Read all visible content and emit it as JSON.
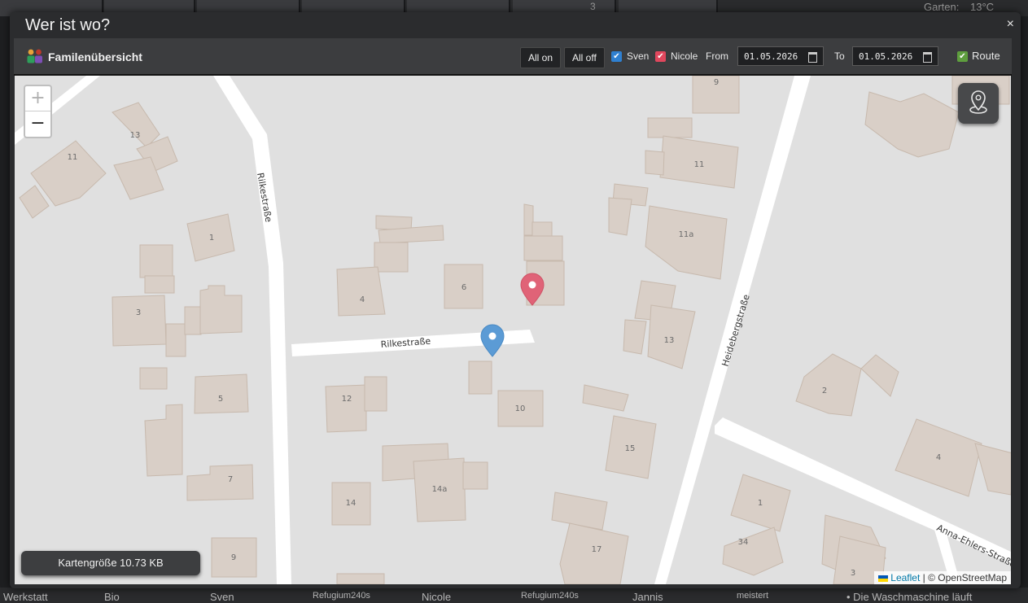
{
  "background": {
    "garden_label": "Garten:",
    "garden_temp": "13°C",
    "tile_number": "3",
    "bottom_items": [
      "Werkstatt",
      "Bio",
      "Sven",
      "Refugium240s",
      "Nicole",
      "Refugium240s",
      "Jannis",
      "meistert",
      "• Die Waschmaschine läuft"
    ]
  },
  "dialog": {
    "title": "Wer ist wo?",
    "close_symbol": "×"
  },
  "toolbar": {
    "title": "Familenübersicht",
    "all_on": "All on",
    "all_off": "All off",
    "persons": [
      {
        "name": "Sven",
        "checked": true,
        "color": "#2f80d1"
      },
      {
        "name": "Nicole",
        "checked": true,
        "color": "#e0475d"
      }
    ],
    "from_label": "From",
    "from_value": "01.05.2026",
    "to_label": "To",
    "to_value": "01.05.2026",
    "route_label": "Route",
    "route_checked": true,
    "route_color": "#5e9e3e"
  },
  "map": {
    "zoom_in": "+",
    "zoom_out": "−",
    "size_label": "Kartengröße 10.73 KB",
    "attribution_link": "Leaflet",
    "attribution_rest": "| © OpenStreetMap",
    "streets": {
      "rilke_vertical": "Rilkestraße",
      "rilke_horizontal": "Rilkestraße",
      "heidebergstrasse": "Heidebergstraße",
      "anna_ehlers": "Anna-Ehlers-Straße"
    },
    "house_numbers": [
      "9",
      "13",
      "11",
      "11",
      "11a",
      "1",
      "3",
      "4",
      "6",
      "13",
      "5",
      "12",
      "10",
      "2",
      "7",
      "14",
      "14a",
      "15",
      "4",
      "1",
      "34",
      "17",
      "3",
      "9"
    ],
    "markers": {
      "sven_color": "#5b9bd5",
      "nicole_color": "#e06377"
    }
  }
}
